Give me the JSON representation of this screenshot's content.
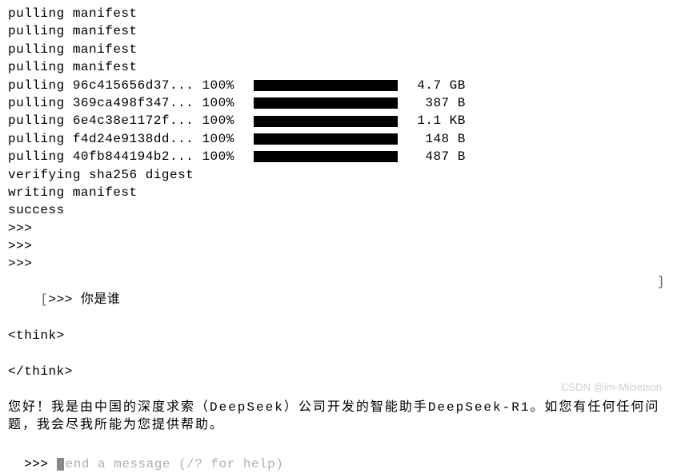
{
  "pulling_manifest": "pulling manifest",
  "pulls": [
    {
      "prefix": "pulling 96c415656d37... 100%  ",
      "size": "4.7 GB"
    },
    {
      "prefix": "pulling 369ca498f347... 100%  ",
      "size": " 387 B"
    },
    {
      "prefix": "pulling 6e4c38e1172f... 100%  ",
      "size": "1.1 KB"
    },
    {
      "prefix": "pulling f4d24e9138dd... 100%  ",
      "size": " 148 B"
    },
    {
      "prefix": "pulling 40fb844194b2... 100%  ",
      "size": " 487 B"
    }
  ],
  "verifying": "verifying sha256 digest",
  "writing": "writing manifest",
  "success": "success",
  "empty_prompt": ">>>",
  "user_prompt_prefix": ">>> ",
  "user_question": "你是谁",
  "think_open": "<think>",
  "think_close": "</think>",
  "response": "您好！我是由中国的深度求索（DeepSeek）公司开发的智能助手DeepSeek-R1。如您有任何任何问题，我会尽我所能为您提供帮助。",
  "input_prompt": ">>> ",
  "input_placeholder": "end a message (/? for help)",
  "left_bracket": "[",
  "right_bracket": "]",
  "watermark": "CSDN @im-Miclelson"
}
